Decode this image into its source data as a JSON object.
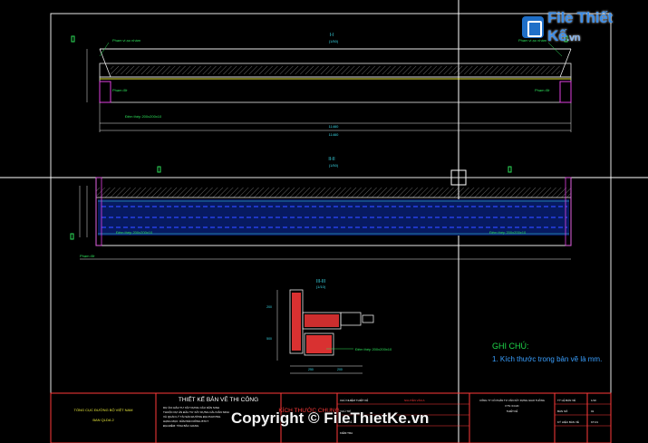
{
  "logo": {
    "brand": "File Thiết Kế",
    "suffix": ".vn",
    "icon": "file-icon"
  },
  "watermark": "Copyright © FileThietKe.vn",
  "notes": {
    "title": "GHI CHÚ:",
    "items": [
      "1. Kích thước trong bản vẽ là mm."
    ]
  },
  "drawing": {
    "elevation_1": {
      "label": "I-I",
      "scale": "(1/50)",
      "dims": [
        "11460",
        "11460"
      ],
      "tags": [
        "Phạm vi ạo nhám",
        "Phạm vi ạo nhám",
        "Phạm đỡ",
        "Phạm đỡ",
        "Đệm thép 200x200x10"
      ]
    },
    "elevation_2": {
      "label": "II-II",
      "scale": "(1/50)",
      "tags": [
        "Đệm thép 200x200x10",
        "Đệm thép 200x200x10",
        "Phạm đỡ"
      ]
    },
    "section": {
      "label": "III-III",
      "scale": "(1/10)",
      "tags": [
        "Đệm thép 200x200x10"
      ],
      "dims": [
        "200",
        "500",
        "250",
        "200"
      ]
    },
    "colors": {
      "frame": "#ffffff",
      "cyan": "#3ad7e6",
      "green": "#2ee05a",
      "blue": "#2d48ff",
      "red": "#ff3a3a",
      "yellow": "#e6e63a",
      "magenta": "#e040e0"
    }
  },
  "title_block": {
    "agency": [
      "TỔNG CỤC ĐƯỜNG BỘ VIỆT NAM",
      "BAN QLDA 2"
    ],
    "stage": "THIẾT KẾ BẢN VẼ THI CÔNG",
    "stage_notes": [
      "DỰ ÁN: ĐẦU TƯ XÂY DỰNG CẦU DÂN SINH",
      "THUỘC DỰ ÁN ĐẦU TƯ XÂY DỰNG CẦU DÂN SINH",
      "VÀ QUẢN LÝ TÀI SẢN ĐƯỜNG ĐỊA PHƯƠNG",
      "HẠNG MỤC: DẦM BẢN RỖNG BTCT",
      "ĐỊA ĐIỂM: TỈNH BẮC GIANG"
    ],
    "sheet_title": "KÍCH THƯỚC CHUNG",
    "role_labels": [
      "CHỦ NHIỆM THIẾT KẾ",
      "CHỦ TRÌ",
      "THIẾT KẾ",
      "KIỂM TRA"
    ],
    "names": [
      "NGUYỄN VĂN A"
    ],
    "company": [
      "CÔNG TY CỔ PHẦN TƯ VẤN XÂY DỰNG GIAO THÔNG",
      "KTS: 04 HN",
      "THIẾT KẾ"
    ],
    "scale_labels": [
      "TỶ LỆ BẢN VẼ",
      "BẢN SỐ",
      "KÝ HIỆU BẢN VẼ"
    ],
    "scale_values": [
      "1/10",
      "01",
      "KT-01"
    ]
  }
}
